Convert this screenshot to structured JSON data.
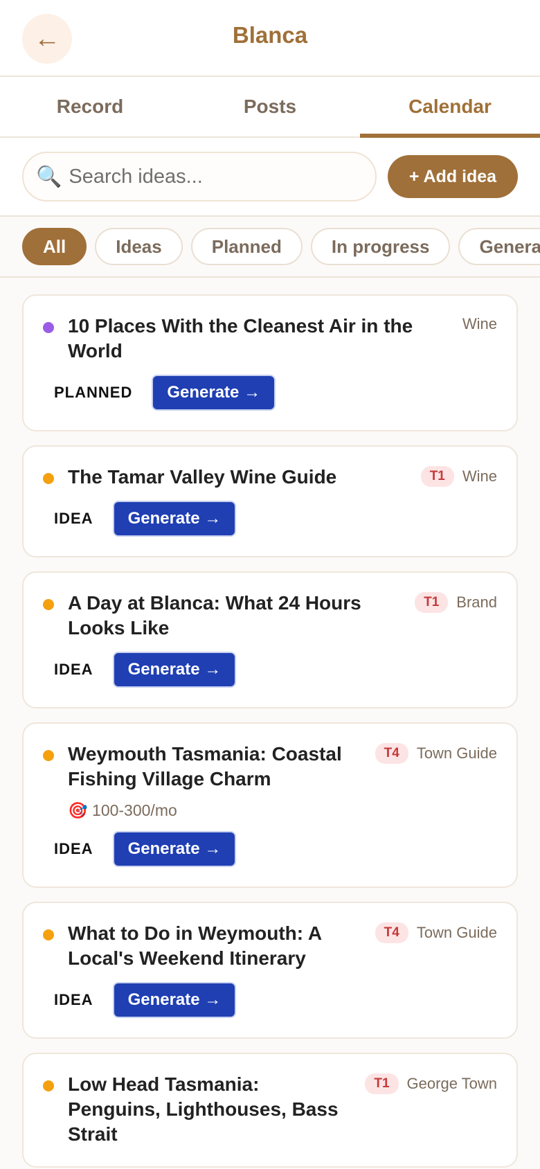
{
  "header": {
    "back_icon": "←",
    "title": "Blanca"
  },
  "tabs": [
    {
      "label": "Record",
      "active": false
    },
    {
      "label": "Posts",
      "active": false
    },
    {
      "label": "Calendar",
      "active": true
    }
  ],
  "search": {
    "icon": "🔍",
    "placeholder": "Search ideas...",
    "value": ""
  },
  "add_button": {
    "label": "+ Add idea"
  },
  "filters": [
    {
      "label": "All",
      "active": true
    },
    {
      "label": "Ideas",
      "active": false
    },
    {
      "label": "Planned",
      "active": false
    },
    {
      "label": "In progress",
      "active": false
    },
    {
      "label": "Genera",
      "active": false
    }
  ],
  "colors": {
    "accent": "#a0703a",
    "planned_dot": "#9b5de5",
    "idea_dot": "#f5a00f",
    "generate_bg": "#1f3fb3"
  },
  "ideas": [
    {
      "title": "10 Places With the Cleanest Air in the World",
      "tier": "",
      "category": "Wine",
      "target": "",
      "status": "PLANNED",
      "dot": "#9b5de5",
      "action": "Generate →"
    },
    {
      "title": "The Tamar Valley Wine Guide",
      "tier": "T1",
      "category": "Wine",
      "target": "",
      "status": "IDEA",
      "dot": "#f5a00f",
      "action": "Generate →"
    },
    {
      "title": "A Day at Blanca: What 24 Hours Looks Like",
      "tier": "T1",
      "category": "Brand",
      "target": "",
      "status": "IDEA",
      "dot": "#f5a00f",
      "action": "Generate →"
    },
    {
      "title": "Weymouth Tasmania: Coastal Fishing Village Charm",
      "tier": "T4",
      "category": "Town Guide",
      "target": "🎯 100-300/mo",
      "status": "IDEA",
      "dot": "#f5a00f",
      "action": "Generate →"
    },
    {
      "title": "What to Do in Weymouth: A Local's Weekend Itinerary",
      "tier": "T4",
      "category": "Town Guide",
      "target": "",
      "status": "IDEA",
      "dot": "#f5a00f",
      "action": "Generate →"
    },
    {
      "title": "Low Head Tasmania: Penguins, Lighthouses, Bass Strait",
      "tier": "T1",
      "category": "George Town",
      "target": "",
      "status": "",
      "dot": "#f5a00f",
      "action": ""
    }
  ]
}
